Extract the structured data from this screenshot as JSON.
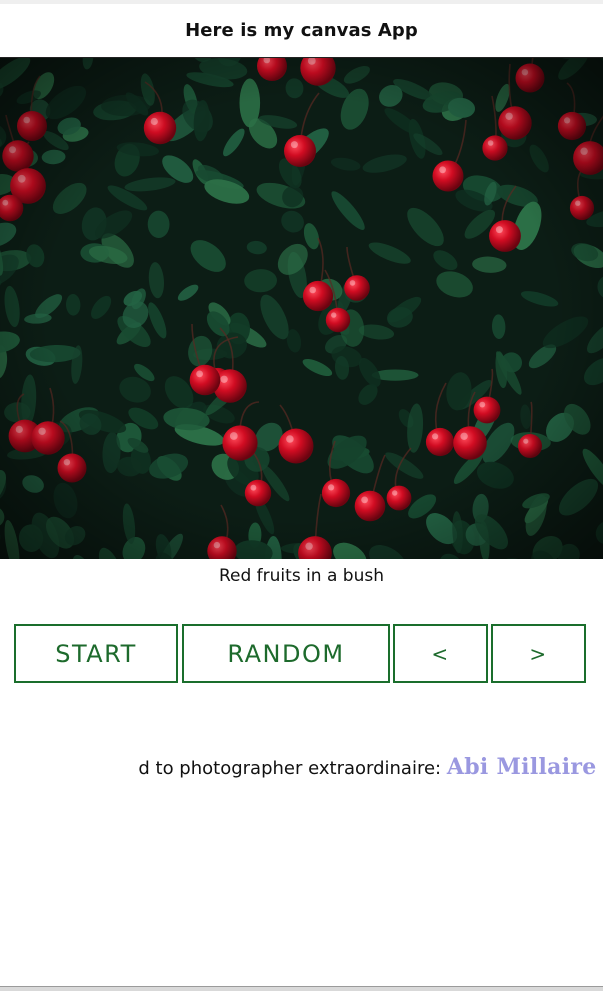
{
  "header": {
    "title": "Here is my canvas App"
  },
  "photo": {
    "alt": "Red fruits in a bush",
    "caption": "Red fruits in a bush"
  },
  "controls": {
    "start_label": "START",
    "random_label": "RANDOM",
    "prev_label": "<",
    "next_label": ">"
  },
  "credit": {
    "prefix": "d to photographer extraordinaire: ",
    "author": "Abi Millaire (@parker.p"
  },
  "colors": {
    "button_border": "#1a6e2c",
    "button_text": "#1d6a2c",
    "author_link": "#9a98e0"
  }
}
